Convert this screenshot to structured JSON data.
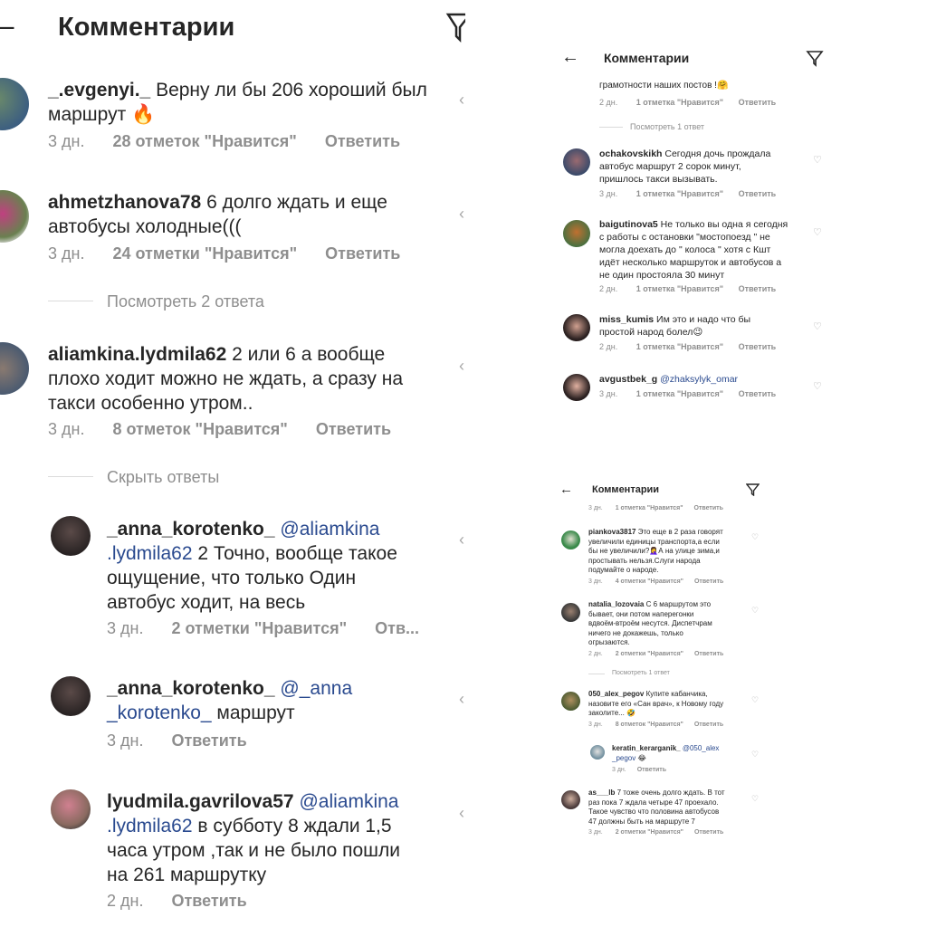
{
  "left": {
    "title": "Комментарии",
    "back_icon": "back-arrow-icon",
    "filter_icon": "filter-icon",
    "comments": [
      {
        "user": "_.evgenyi._",
        "lines": [
          " Верну ли бы 206 хороший был",
          "маршрут 🔥"
        ],
        "time": "3 дн.",
        "likes": "28 отметок \"Нравится\"",
        "reply": "Ответить"
      },
      {
        "user": "ahmetzhanova78",
        "lines": [
          " 6 долго ждать и еще",
          "автобусы холодные((("
        ],
        "time": "3 дн.",
        "likes": "24 отметки \"Нравится\"",
        "reply": "Ответить"
      },
      {
        "user": "aliamkina.lydmila62",
        "lines": [
          " 2 или 6 а вообще",
          "плохо ходит можно не ждать, а сразу на",
          "такси особенно утром.."
        ],
        "time": "3 дн.",
        "likes": "8 отметок \"Нравится\"",
        "reply": "Ответить"
      },
      {
        "user": "_anna_korotenko_",
        "mention": " @aliamkina",
        "lines": [
          ".lydmila62  2 Точно, вообще такое",
          "ощущение, что только Один",
          "автобус  ходит, на весь"
        ],
        "time": "3 дн.",
        "likes": "2 отметки \"Нравится\"",
        "reply": "Отв..."
      },
      {
        "user": "_anna_korotenko_",
        "mention": " @_anna",
        "mention2": "_korotenko_",
        "lines": [
          " маршрут"
        ],
        "time": "3 дн.",
        "reply": "Ответить"
      },
      {
        "user": "lyudmila.gavrilova57",
        "mention": " @aliamkina",
        "mention2": ".lydmila62",
        "lines": [
          " в субботу 8 ждали 1,5",
          "часа утром ,так и не было пошли",
          "на 261 маршрутку"
        ],
        "time": "2 дн.",
        "reply": "Ответить"
      }
    ],
    "view_replies": "Посмотреть 2 ответа",
    "hide_replies": "Скрыть ответы"
  },
  "top_right": {
    "title": "Комментарии",
    "partial_text": "грамотности наших постов !🤗",
    "partial_meta": {
      "time": "2 дн.",
      "likes": "1 отметка \"Нравится\"",
      "reply": "Ответить"
    },
    "view_replies": "Посмотреть 1 ответ",
    "comments": [
      {
        "user": "ochakovskikh",
        "lines": [
          " Сегодня дочь прождала",
          "автобус маршрут 2  сорок минут,",
          "пришлось такси вызывать."
        ],
        "time": "3 дн.",
        "likes": "1 отметка \"Нравится\"",
        "reply": "Ответить"
      },
      {
        "user": "baigutinova5",
        "lines": [
          " Не только вы одна я сегодня",
          "с работы с остановки \"мостопоезд \" не",
          "могла доехать до \" колоса \" хотя с Кшт",
          "идёт несколько маршруток и автобусов а",
          "не один простояла 30 минут"
        ],
        "time": "2 дн.",
        "likes": "1 отметка \"Нравится\"",
        "reply": "Ответить"
      },
      {
        "user": "miss_kumis",
        "lines": [
          " Им это и надо  что бы",
          "простой народ болел😉"
        ],
        "time": "2 дн.",
        "likes": "1 отметка \"Нравится\"",
        "reply": "Ответить"
      },
      {
        "user": "avgustbek_g",
        "mention": " @zhaksylyk_omar",
        "lines": [],
        "time": "3 дн.",
        "likes": "1 отметка \"Нравится\"",
        "reply": "Ответить"
      }
    ]
  },
  "bottom_right": {
    "title": "Комментарии",
    "top_meta": {
      "time": "3 дн.",
      "likes": "1 отметка \"Нравится\"",
      "reply": "Ответить"
    },
    "view_replies": "Посмотреть 1 ответ",
    "comments": [
      {
        "user": "piankova3817",
        "lines": [
          " Это еще в 2 раза говорят",
          "увеличили единицы транспорта,а если",
          "бы не увеличили?🤦‍♀️А на улице зима,и",
          "простывать нельзя.Слуги народа",
          "подумайте о народе."
        ],
        "time": "3 дн.",
        "likes": "4 отметки \"Нравится\"",
        "reply": "Ответить"
      },
      {
        "user": "natalia_lozovaia",
        "lines": [
          " С 6 маршрутом это",
          "бывает, они потом наперегонки",
          "вдвоём-втроём несутся. Диспетчрам",
          "ничего не докажешь, только",
          "огрызаются."
        ],
        "time": "2 дн.",
        "likes": "2 отметки \"Нравится\"",
        "reply": "Ответить"
      },
      {
        "user": "050_alex_pegov",
        "lines": [
          " Купите кабанчика,",
          "назовите его «Сан врач», к Новому году",
          "заколите... 🤣"
        ],
        "time": "3 дн.",
        "likes": "8 отметок \"Нравится\"",
        "reply": "Ответить"
      },
      {
        "user": "keratin_kerarganik_",
        "mention": " @050_alex",
        "mention2": "_pegov",
        "lines": [
          " 😂"
        ],
        "time": "3 дн.",
        "reply": "Ответить"
      },
      {
        "user": "as___lb",
        "lines": [
          " 7 тоже очень долго ждать. В тот",
          "раз пока 7 ждала четыре 47 проехало.",
          "Такое чувство что половина автобусов",
          "47 должны быть на маршруте 7"
        ],
        "time": "3 дн.",
        "likes": "2 отметки \"Нравится\"",
        "reply": "Ответить"
      }
    ]
  },
  "colors": {
    "text": "#262626",
    "meta": "#8e8e8e",
    "mention": "#2a4a8f",
    "separator": "#dbdbdb"
  }
}
